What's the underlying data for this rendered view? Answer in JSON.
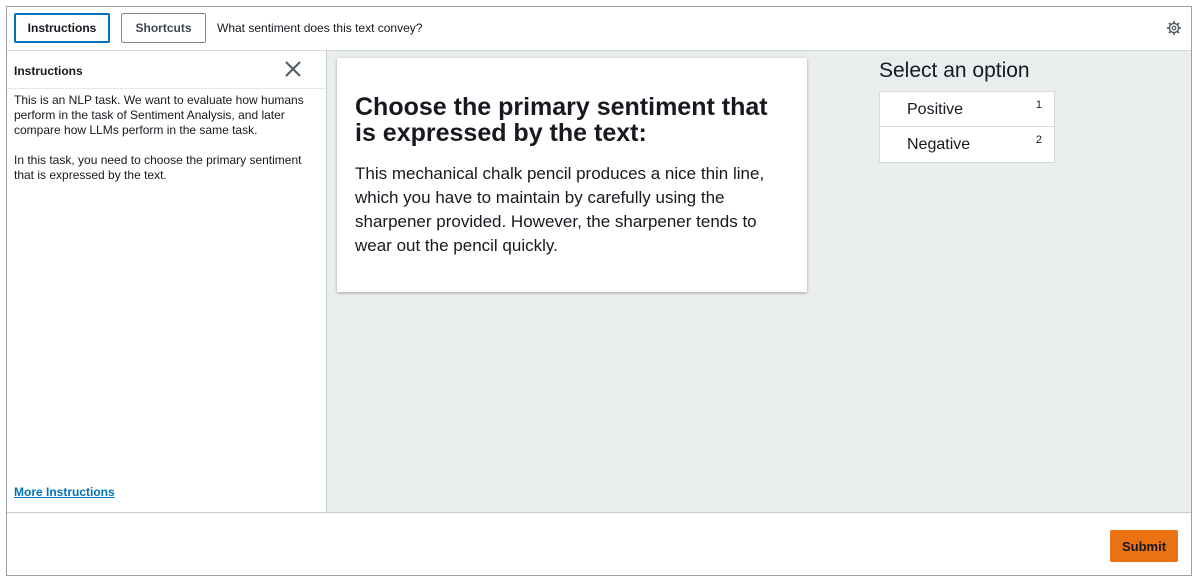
{
  "topbar": {
    "instructions_label": "Instructions",
    "shortcuts_label": "Shortcuts",
    "question": "What sentiment does this text convey?"
  },
  "instructions_panel": {
    "title": "Instructions",
    "paragraphs": [
      "This is an NLP task. We want to evaluate how humans perform in the task of Sentiment Analysis, and later compare how LLMs perform in the same task.",
      "In this task, you need to choose the primary sentiment that is expressed by the text."
    ],
    "more_link": "More Instructions"
  },
  "task_card": {
    "heading": "Choose the primary sentiment that is expressed by the text:",
    "text": "This mechanical chalk pencil produces a nice thin line, which you have to maintain by carefully using the sharpener provided. However, the sharpener tends to wear out the pencil quickly."
  },
  "options": {
    "title": "Select an option",
    "items": [
      {
        "label": "Positive",
        "key": "1"
      },
      {
        "label": "Negative",
        "key": "2"
      }
    ]
  },
  "footer": {
    "submit_label": "Submit"
  },
  "colors": {
    "accent": "#0073bb",
    "submit": "#ec7211",
    "background": "#eaeded"
  },
  "icons": {
    "settings": "gear-icon",
    "close": "close-icon"
  }
}
